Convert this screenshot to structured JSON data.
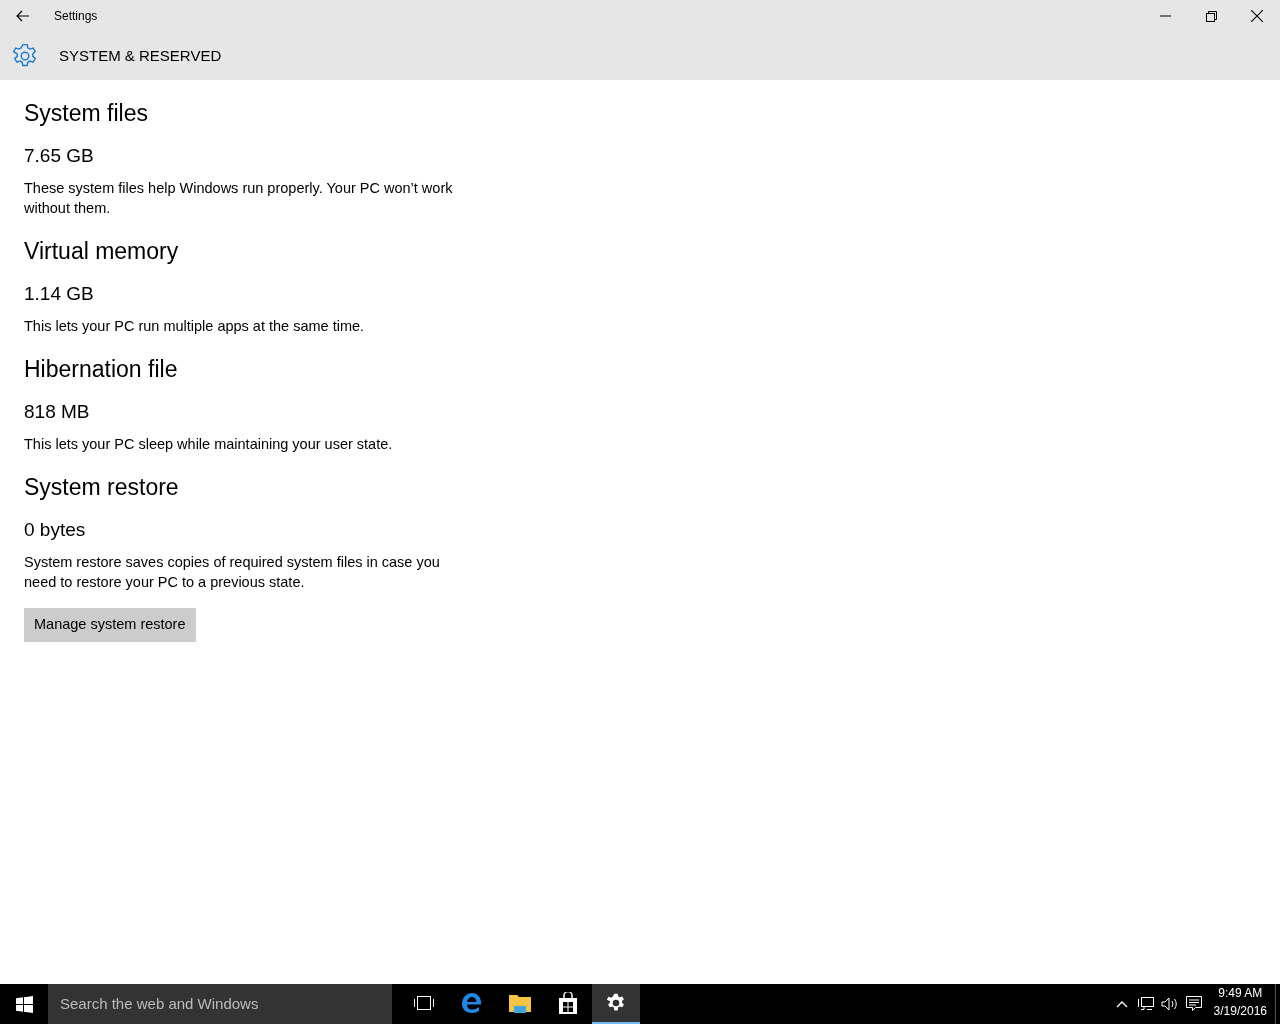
{
  "window": {
    "title": "Settings"
  },
  "header": {
    "title": "SYSTEM & RESERVED"
  },
  "sections": [
    {
      "heading": "System files",
      "size": "7.65 GB",
      "description": "These system files help Windows run properly. Your PC won’t work without them."
    },
    {
      "heading": "Virtual memory",
      "size": "1.14 GB",
      "description": "This lets your PC run multiple apps at the same time."
    },
    {
      "heading": "Hibernation file",
      "size": "818 MB",
      "description": "This lets your PC sleep while maintaining your user state."
    },
    {
      "heading": "System restore",
      "size": "0 bytes",
      "description": "System restore saves copies of required system files in case you need to restore your PC to a previous state.",
      "button": "Manage system restore"
    }
  ],
  "taskbar": {
    "search": {
      "placeholder": "Search the web and Windows"
    },
    "apps": [
      {
        "kind": "task-view",
        "selected": false
      },
      {
        "kind": "browser",
        "selected": false
      },
      {
        "kind": "folder",
        "selected": false
      },
      {
        "kind": "store",
        "selected": false
      },
      {
        "kind": "settings",
        "selected": true
      }
    ],
    "clock": {
      "time": "9:49 AM",
      "date": "3/19/2016"
    }
  }
}
